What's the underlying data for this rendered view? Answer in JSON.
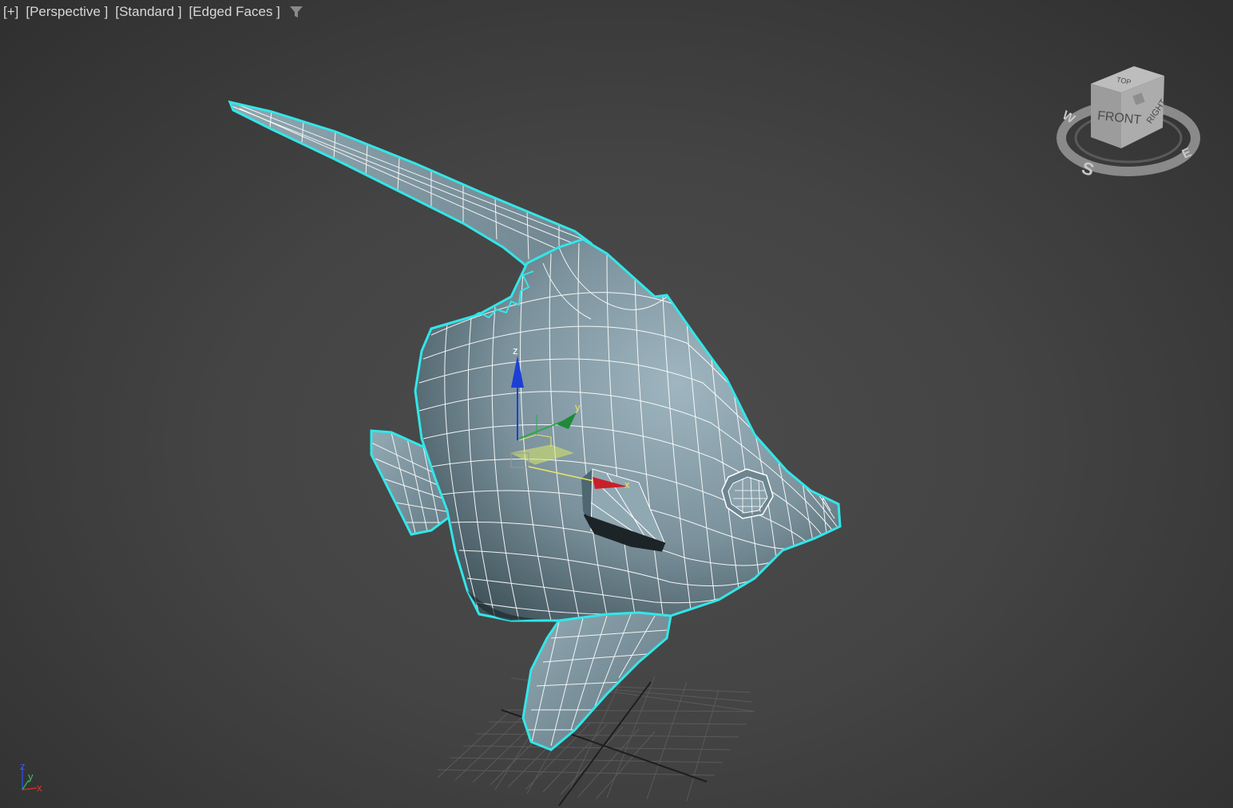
{
  "viewport": {
    "labels": {
      "plus": "[+]",
      "view": "[Perspective ]",
      "shading": "[Standard ]",
      "style": "[Edged Faces ]"
    },
    "filter_icon": "funnel-icon"
  },
  "viewcube": {
    "top": "TOP",
    "front": "FRONT",
    "right": "RIGHT",
    "compass": {
      "w": "W",
      "s": "S",
      "e": "E"
    }
  },
  "gizmo": {
    "x": "x",
    "y": "y",
    "z": "z"
  },
  "world_axes": {
    "x": "x",
    "y": "y",
    "z": "z"
  },
  "colors": {
    "background": "#444444",
    "mesh": "#7d95a0",
    "wire": "#ffffff",
    "selection": "#33e6e8",
    "x_axis": "#c8202a",
    "y_axis": "#2aa84a",
    "z_axis": "#1c3fd6"
  }
}
